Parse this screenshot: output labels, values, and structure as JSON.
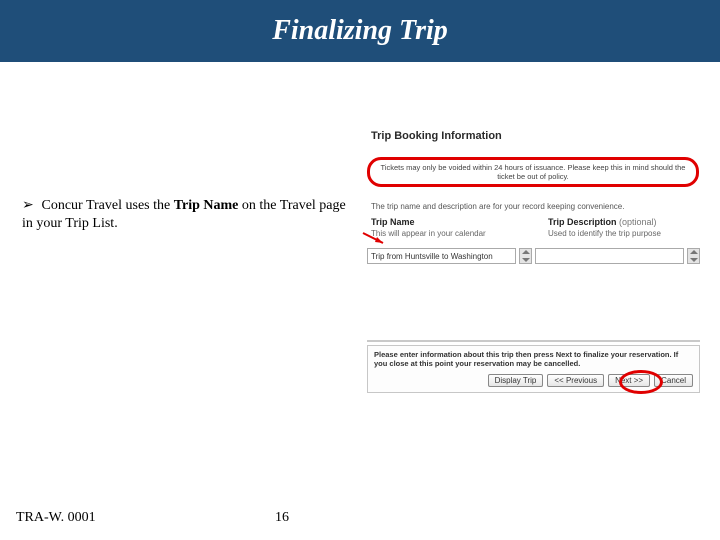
{
  "title": "Finalizing Trip",
  "section_heading": "Trip Booking Information",
  "ticket_notice": "Tickets may only be voided within 24 hours of issuance. Please keep this in mind should the ticket be out of policy.",
  "bullet": {
    "marker": "➢",
    "pre": "Concur Travel uses the ",
    "bold": "Trip Name",
    "post": " on the Travel page in your Trip List."
  },
  "record_note": "The trip name and description are for your record keeping convenience.",
  "fields": {
    "name": {
      "label": "Trip Name",
      "sub": "This will appear in your calendar",
      "value": "Trip from Huntsville to Washington"
    },
    "desc": {
      "label": "Trip Description",
      "optional": "(optional)",
      "sub": "Used to identify the trip purpose",
      "value": ""
    }
  },
  "finalize_msg": "Please enter information about this trip then press Next to finalize your reservation. If you close at this point your reservation may be cancelled.",
  "buttons": {
    "display": "Display Trip",
    "prev": "<< Previous",
    "next": "Next >>",
    "cancel": "Cancel"
  },
  "footer": {
    "code": "TRA-W. 0001",
    "page": "16"
  }
}
